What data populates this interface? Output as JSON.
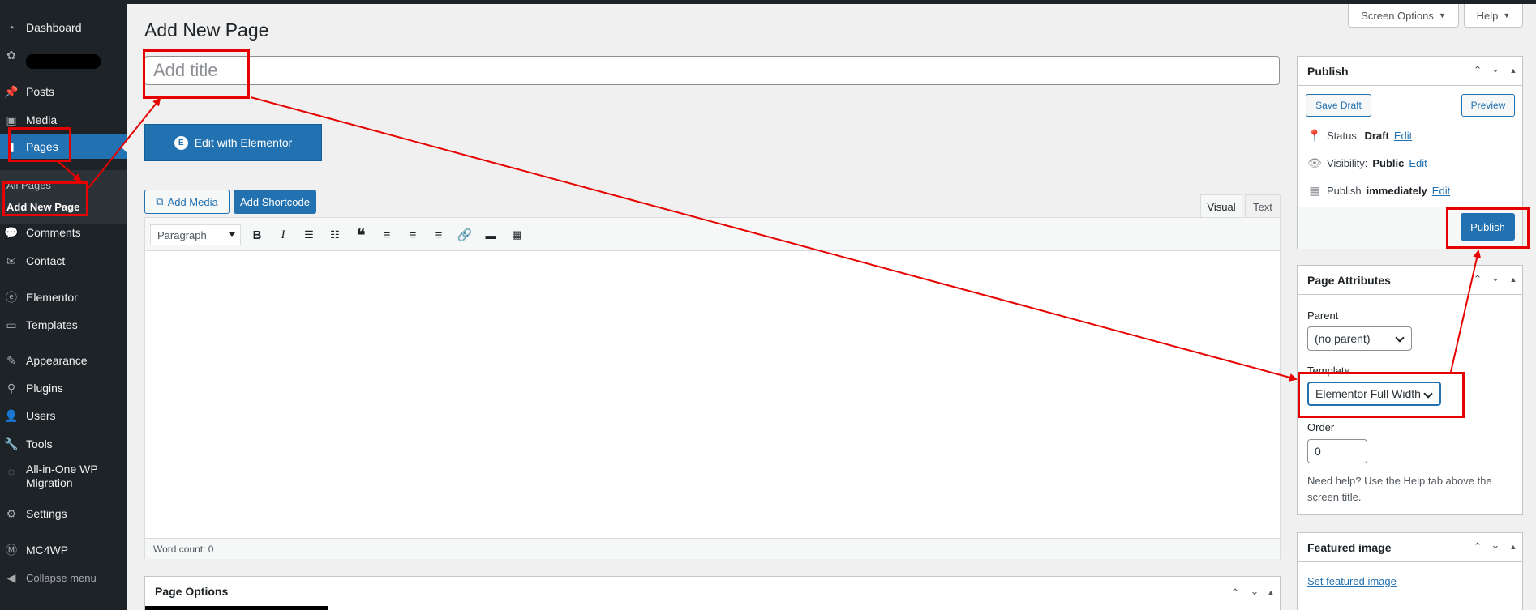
{
  "sidebar": {
    "items": [
      {
        "label": "Dashboard",
        "icon": "dashboard-icon"
      },
      {
        "label": "",
        "icon": "gear-icon"
      },
      {
        "label": "Posts",
        "icon": "pin-icon"
      },
      {
        "label": "Media",
        "icon": "media-icon"
      },
      {
        "label": "Pages",
        "icon": "page-icon"
      },
      {
        "label": "Comments",
        "icon": "comment-icon"
      },
      {
        "label": "Contact",
        "icon": "mail-icon"
      },
      {
        "label": "Elementor",
        "icon": "elementor-icon"
      },
      {
        "label": "Templates",
        "icon": "folder-icon"
      },
      {
        "label": "Appearance",
        "icon": "brush-icon"
      },
      {
        "label": "Plugins",
        "icon": "plugin-icon"
      },
      {
        "label": "Users",
        "icon": "user-icon"
      },
      {
        "label": "Tools",
        "icon": "wrench-icon"
      },
      {
        "label": "All-in-One WP Migration",
        "icon": "migration-icon"
      },
      {
        "label": "Settings",
        "icon": "settings-icon"
      },
      {
        "label": "MC4WP",
        "icon": "mc4wp-icon"
      },
      {
        "label": "Collapse menu",
        "icon": "collapse-icon"
      }
    ],
    "submenu": [
      "All Pages",
      "Add New Page"
    ]
  },
  "header": {
    "title": "Add New Page",
    "screen_options": "Screen Options",
    "help": "Help"
  },
  "editor": {
    "title_placeholder": "Add title",
    "elementor_button": "Edit with Elementor",
    "add_media": "Add Media",
    "add_shortcode": "Add Shortcode",
    "tab_visual": "Visual",
    "tab_text": "Text",
    "format": "Paragraph",
    "word_count": "Word count: 0"
  },
  "page_options": {
    "title": "Page Options"
  },
  "publish": {
    "title": "Publish",
    "save_draft": "Save Draft",
    "preview": "Preview",
    "status_label": "Status:",
    "status_value": "Draft",
    "visibility_label": "Visibility:",
    "visibility_value": "Public",
    "publish_label": "Publish",
    "publish_value": "immediately",
    "edit": "Edit",
    "publish_button": "Publish"
  },
  "page_attributes": {
    "title": "Page Attributes",
    "parent_label": "Parent",
    "parent_value": "(no parent)",
    "template_label": "Template",
    "template_value": "Elementor Full Width",
    "order_label": "Order",
    "order_value": "0",
    "help": "Need help? Use the Help tab above the screen title."
  },
  "featured_image": {
    "title": "Featured image",
    "set_link": "Set featured image"
  },
  "colors": {
    "sidebar": "#1d2327",
    "accent": "#2271b1",
    "annotation": "#e60000"
  }
}
